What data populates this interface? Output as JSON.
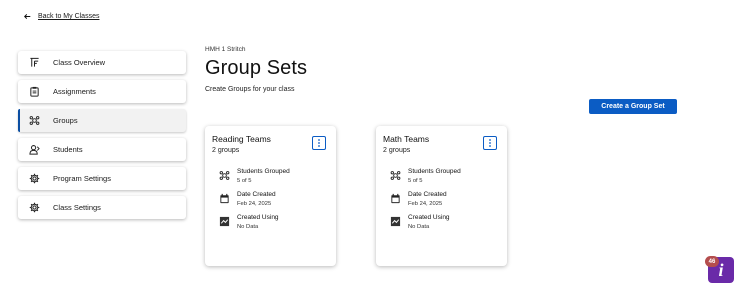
{
  "back_link": {
    "label": "Back to My Classes",
    "icon": "arrow-back-icon"
  },
  "sidebar": {
    "items": [
      {
        "label": "Class Overview",
        "icon": "class-overview-icon",
        "active": false
      },
      {
        "label": "Assignments",
        "icon": "clipboard-icon",
        "active": false
      },
      {
        "label": "Groups",
        "icon": "groups-icon",
        "active": true
      },
      {
        "label": "Students",
        "icon": "students-icon",
        "active": false
      },
      {
        "label": "Program Settings",
        "icon": "gear-icon",
        "active": false
      },
      {
        "label": "Class Settings",
        "icon": "gear-icon",
        "active": false
      }
    ]
  },
  "header": {
    "class_name": "HMH 1 Stritch",
    "title": "Group Sets",
    "subtitle": "Create Groups for your class"
  },
  "create_button": {
    "label": "Create a Group Set"
  },
  "cards": [
    {
      "title": "Reading Teams",
      "count": "2 groups",
      "stats": [
        {
          "label": "Students Grouped",
          "value": "5 of 5",
          "icon": "groups-icon"
        },
        {
          "label": "Date Created",
          "value": "Feb 24, 2025",
          "icon": "calendar-icon"
        },
        {
          "label": "Created Using",
          "value": "No Data",
          "icon": "trend-icon"
        }
      ]
    },
    {
      "title": "Math Teams",
      "count": "2 groups",
      "stats": [
        {
          "label": "Students Grouped",
          "value": "5 of 5",
          "icon": "groups-icon"
        },
        {
          "label": "Date Created",
          "value": "Feb 24, 2025",
          "icon": "calendar-icon"
        },
        {
          "label": "Created Using",
          "value": "No Data",
          "icon": "trend-icon"
        }
      ]
    }
  ],
  "help_widget": {
    "count": "46",
    "glyph": "i"
  },
  "colors": {
    "accent": "#0b5cc4",
    "active_bar": "#0b4ea2",
    "help_bg": "#6a2aa8",
    "badge_bg": "#b44d4d"
  }
}
